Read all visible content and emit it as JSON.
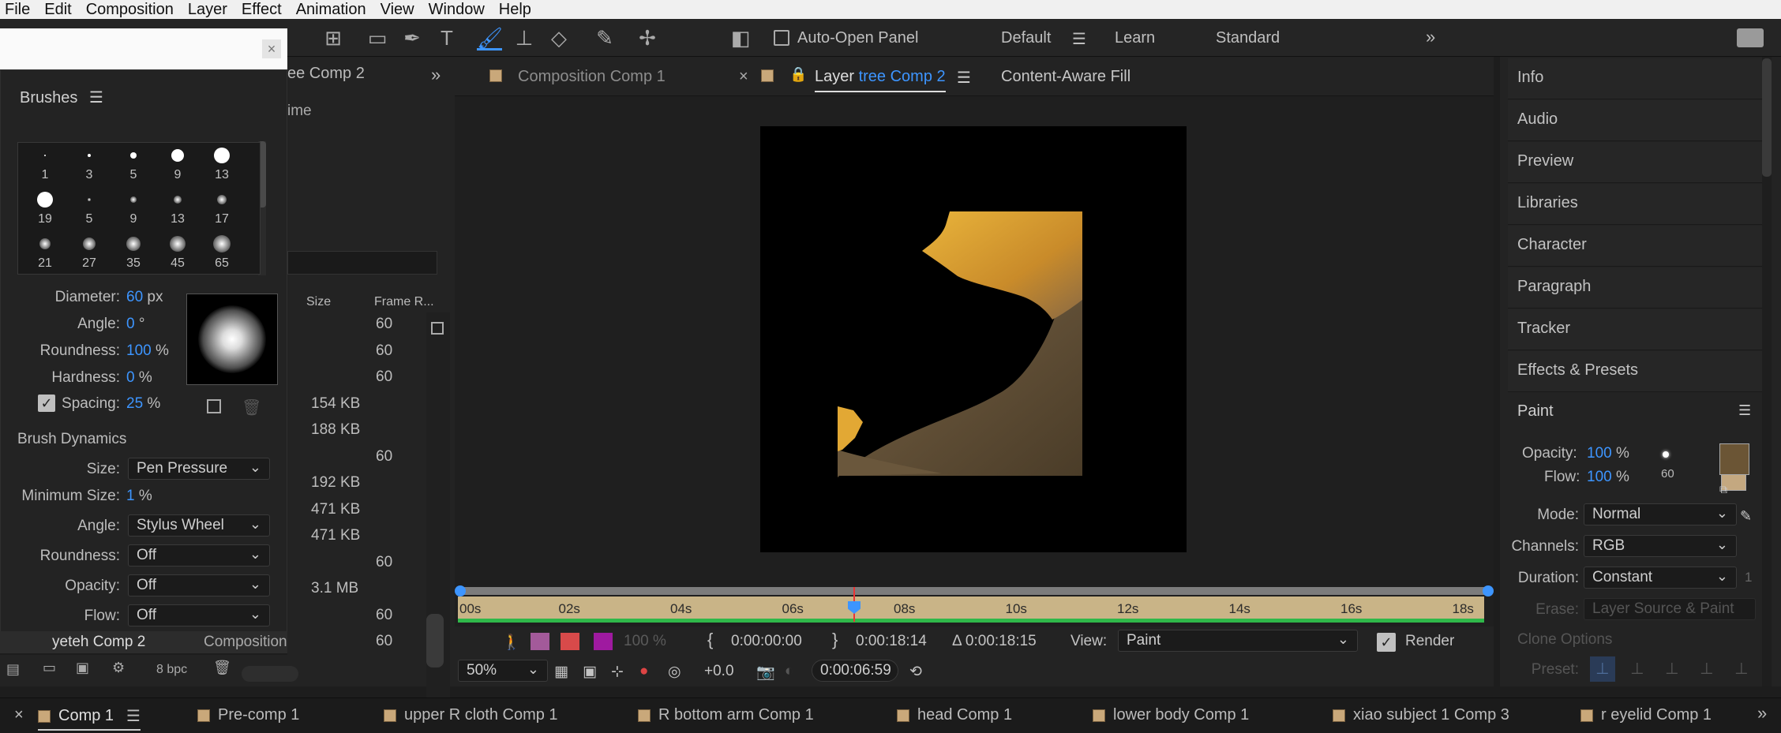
{
  "menu": [
    "File",
    "Edit",
    "Composition",
    "Layer",
    "Effect",
    "Animation",
    "View",
    "Window",
    "Help"
  ],
  "toolbar": {
    "auto_open": "Auto-Open Panel",
    "workspaces": [
      "Default",
      "Learn",
      "Standard"
    ]
  },
  "project_panel": {
    "tab_label": "ee Comp 2",
    "subtitle": "ime",
    "col_size": "Size",
    "col_frame": "Frame R...",
    "rows": [
      {
        "size": "",
        "fr": "60"
      },
      {
        "size": "",
        "fr": "60"
      },
      {
        "size": "",
        "fr": "60"
      },
      {
        "size": "154 KB",
        "fr": ""
      },
      {
        "size": "188 KB",
        "fr": ""
      },
      {
        "size": "",
        "fr": "60"
      },
      {
        "size": "192 KB",
        "fr": ""
      },
      {
        "size": "471 KB",
        "fr": ""
      },
      {
        "size": "471 KB",
        "fr": ""
      },
      {
        "size": "",
        "fr": "60"
      },
      {
        "size": "3.1 MB",
        "fr": ""
      },
      {
        "size": "",
        "fr": "60"
      },
      {
        "size": "",
        "fr": "60"
      }
    ],
    "last_row_name": "yeteh Comp 2",
    "last_row_type": "Composition",
    "bpc": "8 bpc"
  },
  "brushes": {
    "title": "Brushes",
    "grid": [
      "1",
      "3",
      "5",
      "9",
      "13",
      "19",
      "5",
      "9",
      "13",
      "17",
      "21",
      "27",
      "35",
      "45",
      "65"
    ],
    "diameter_label": "Diameter:",
    "diameter": "60",
    "diameter_unit": "px",
    "angle_label": "Angle:",
    "angle": "0",
    "angle_unit": "°",
    "roundness_label": "Roundness:",
    "roundness": "100",
    "roundness_unit": "%",
    "hardness_label": "Hardness:",
    "hardness": "0",
    "hardness_unit": "%",
    "spacing_label": "Spacing:",
    "spacing": "25",
    "spacing_unit": "%",
    "dynamics_title": "Brush Dynamics",
    "size_label": "Size:",
    "size_val": "Pen Pressure",
    "minsize_label": "Minimum Size:",
    "minsize": "1",
    "minsize_unit": "%",
    "dangle_label": "Angle:",
    "dangle_val": "Stylus Wheel",
    "droundness_label": "Roundness:",
    "droundness_val": "Off",
    "dopacity_label": "Opacity:",
    "dopacity_val": "Off",
    "flow_label": "Flow:",
    "flow_val": "Off"
  },
  "viewer": {
    "tab1_prefix": "Composition",
    "tab1_name": "Comp 1",
    "tab2_prefix": "Layer",
    "tab2_name": "tree Comp 2",
    "tab3": "Content-Aware Fill"
  },
  "timeline": {
    "ticks": [
      "00s",
      "02s",
      "04s",
      "06s",
      "08s",
      "10s",
      "12s",
      "14s",
      "16s",
      "18s"
    ],
    "opacity": "100 %",
    "in_time": "0:00:00:00",
    "out_time": "0:00:18:14",
    "duration": "Δ 0:00:18:15",
    "view_label": "View:",
    "view_val": "Paint",
    "render": "Render",
    "zoom": "50%",
    "exposure": "+0.0",
    "current_time": "0:00:06:59"
  },
  "right_panels": [
    "Info",
    "Audio",
    "Preview",
    "Libraries",
    "Character",
    "Paragraph",
    "Tracker",
    "Effects & Presets"
  ],
  "paint": {
    "title": "Paint",
    "opacity_label": "Opacity:",
    "opacity": "100",
    "opacity_unit": "%",
    "flow_label": "Flow:",
    "flow": "100",
    "flow_unit": "%",
    "brush_size": "60",
    "mode_label": "Mode:",
    "mode": "Normal",
    "channels_label": "Channels:",
    "channels": "RGB",
    "duration_label": "Duration:",
    "duration": "Constant",
    "erase_label": "Erase:",
    "erase": "Layer Source & Paint",
    "clone_options": "Clone Options",
    "preset_label": "Preset:",
    "fg_color": "#6b5535",
    "bg_color": "#c4a880",
    "duration_extra": "1"
  },
  "bottom_tabs": [
    "Comp 1",
    "Pre-comp 1",
    "upper R cloth Comp 1",
    "R bottom arm Comp 1",
    "head Comp 1",
    "lower body Comp 1",
    "xiao subject 1 Comp 3",
    "r eyelid Comp 1"
  ]
}
